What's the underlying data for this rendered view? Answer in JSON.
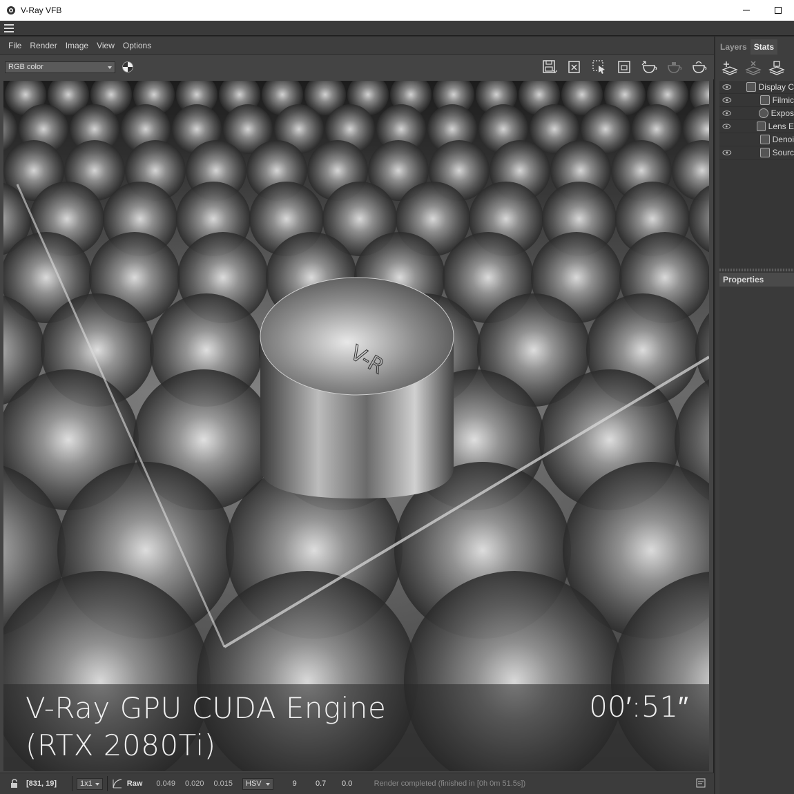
{
  "window": {
    "title": "V-Ray VFB"
  },
  "menu": [
    "File",
    "Render",
    "Image",
    "View",
    "Options"
  ],
  "toolbar": {
    "channel": "RGB color",
    "icons": [
      "save-icon",
      "clear-image-icon",
      "region-render-icon",
      "track-mouse-icon",
      "render-icon",
      "stop-render-icon",
      "render-last-icon"
    ]
  },
  "overlay": {
    "engine_line1": "V-Ray GPU CUDA Engine",
    "engine_line2": "(RTX 2080Ti)",
    "time": "00′:51″"
  },
  "statusbar": {
    "coords": "[831, 19]",
    "zoom": "1x1",
    "mode": "Raw",
    "r": "0.049",
    "g": "0.020",
    "b": "0.015",
    "colorspace": "HSV",
    "h": "9",
    "s": "0.7",
    "v": "0.0",
    "message": "Render completed (finished in [0h  0m 51.5s])"
  },
  "panel": {
    "tabs": [
      "Layers",
      "Stats"
    ],
    "active_tab": "Stats",
    "layers": [
      {
        "label": "Display C",
        "visible": true
      },
      {
        "label": "Filmic",
        "visible": true
      },
      {
        "label": "Expos",
        "visible": true
      },
      {
        "label": "Lens E",
        "visible": true
      },
      {
        "label": "Denoi",
        "visible": false
      },
      {
        "label": "Sourc",
        "visible": true
      }
    ],
    "properties_label": "Properties"
  },
  "colors": {
    "background": "#444444",
    "panel": "#3e3e3e",
    "titlebar": "#ffffff"
  }
}
